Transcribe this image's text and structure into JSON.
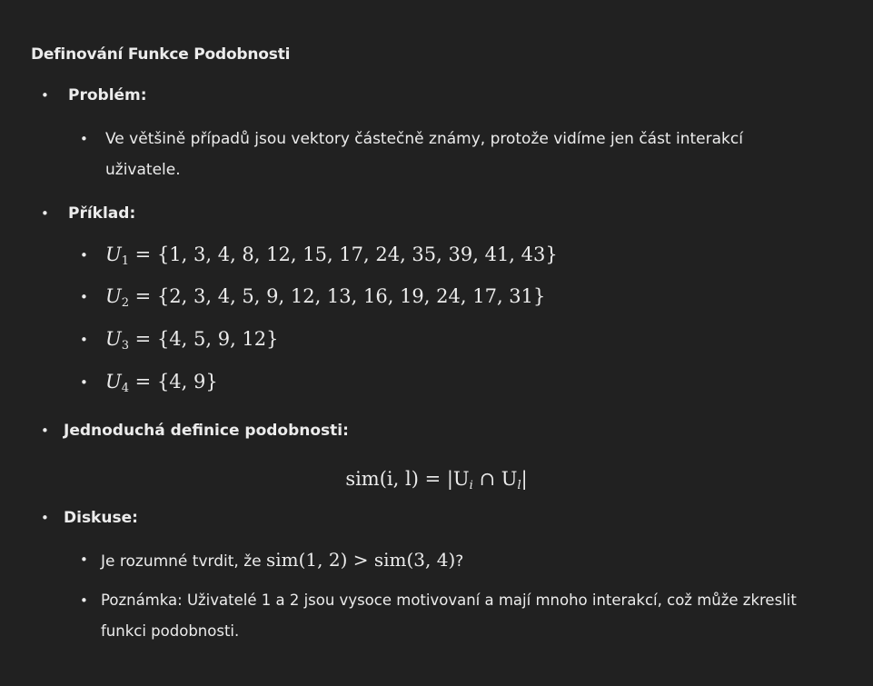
{
  "title": "Definování Funkce Podobnosti",
  "sections": [
    {
      "label": "Problém:",
      "items": [
        "Ve většině případů jsou vektory částečně známy, protože vidíme jen část interakcí",
        "uživatele."
      ]
    },
    {
      "label": "Příklad:",
      "sets": [
        {
          "name": "U",
          "sub": "1",
          "values": "{1, 3, 4, 8, 12, 15, 17, 24, 35, 39, 41, 43}"
        },
        {
          "name": "U",
          "sub": "2",
          "values": "{2, 3, 4, 5, 9, 12, 13, 16, 19, 24, 17, 31}"
        },
        {
          "name": "U",
          "sub": "3",
          "values": "{4, 5, 9, 12}"
        },
        {
          "name": "U",
          "sub": "4",
          "values": "{4, 9}"
        }
      ]
    },
    {
      "label": "Jednoduchá definice podobnosti:",
      "formula": "sim(i, l) = |U",
      "formula_sub_i": "i",
      "formula_cap": " ∩ U",
      "formula_sub_l": "l",
      "formula_end": "|"
    },
    {
      "label": "Diskuse:",
      "q_prefix": "Je rozumné tvrdit, že ",
      "q_math": "sim(1, 2) > sim(3, 4)",
      "q_suffix": "?",
      "note_line1": "Poznámka: Uživatelé 1 a 2 jsou vysoce motivovaní a mají mnoho interakcí, což může zkreslit",
      "note_line2": "funkci podobnosti."
    }
  ],
  "bullet_char": "•",
  "equals": " = "
}
